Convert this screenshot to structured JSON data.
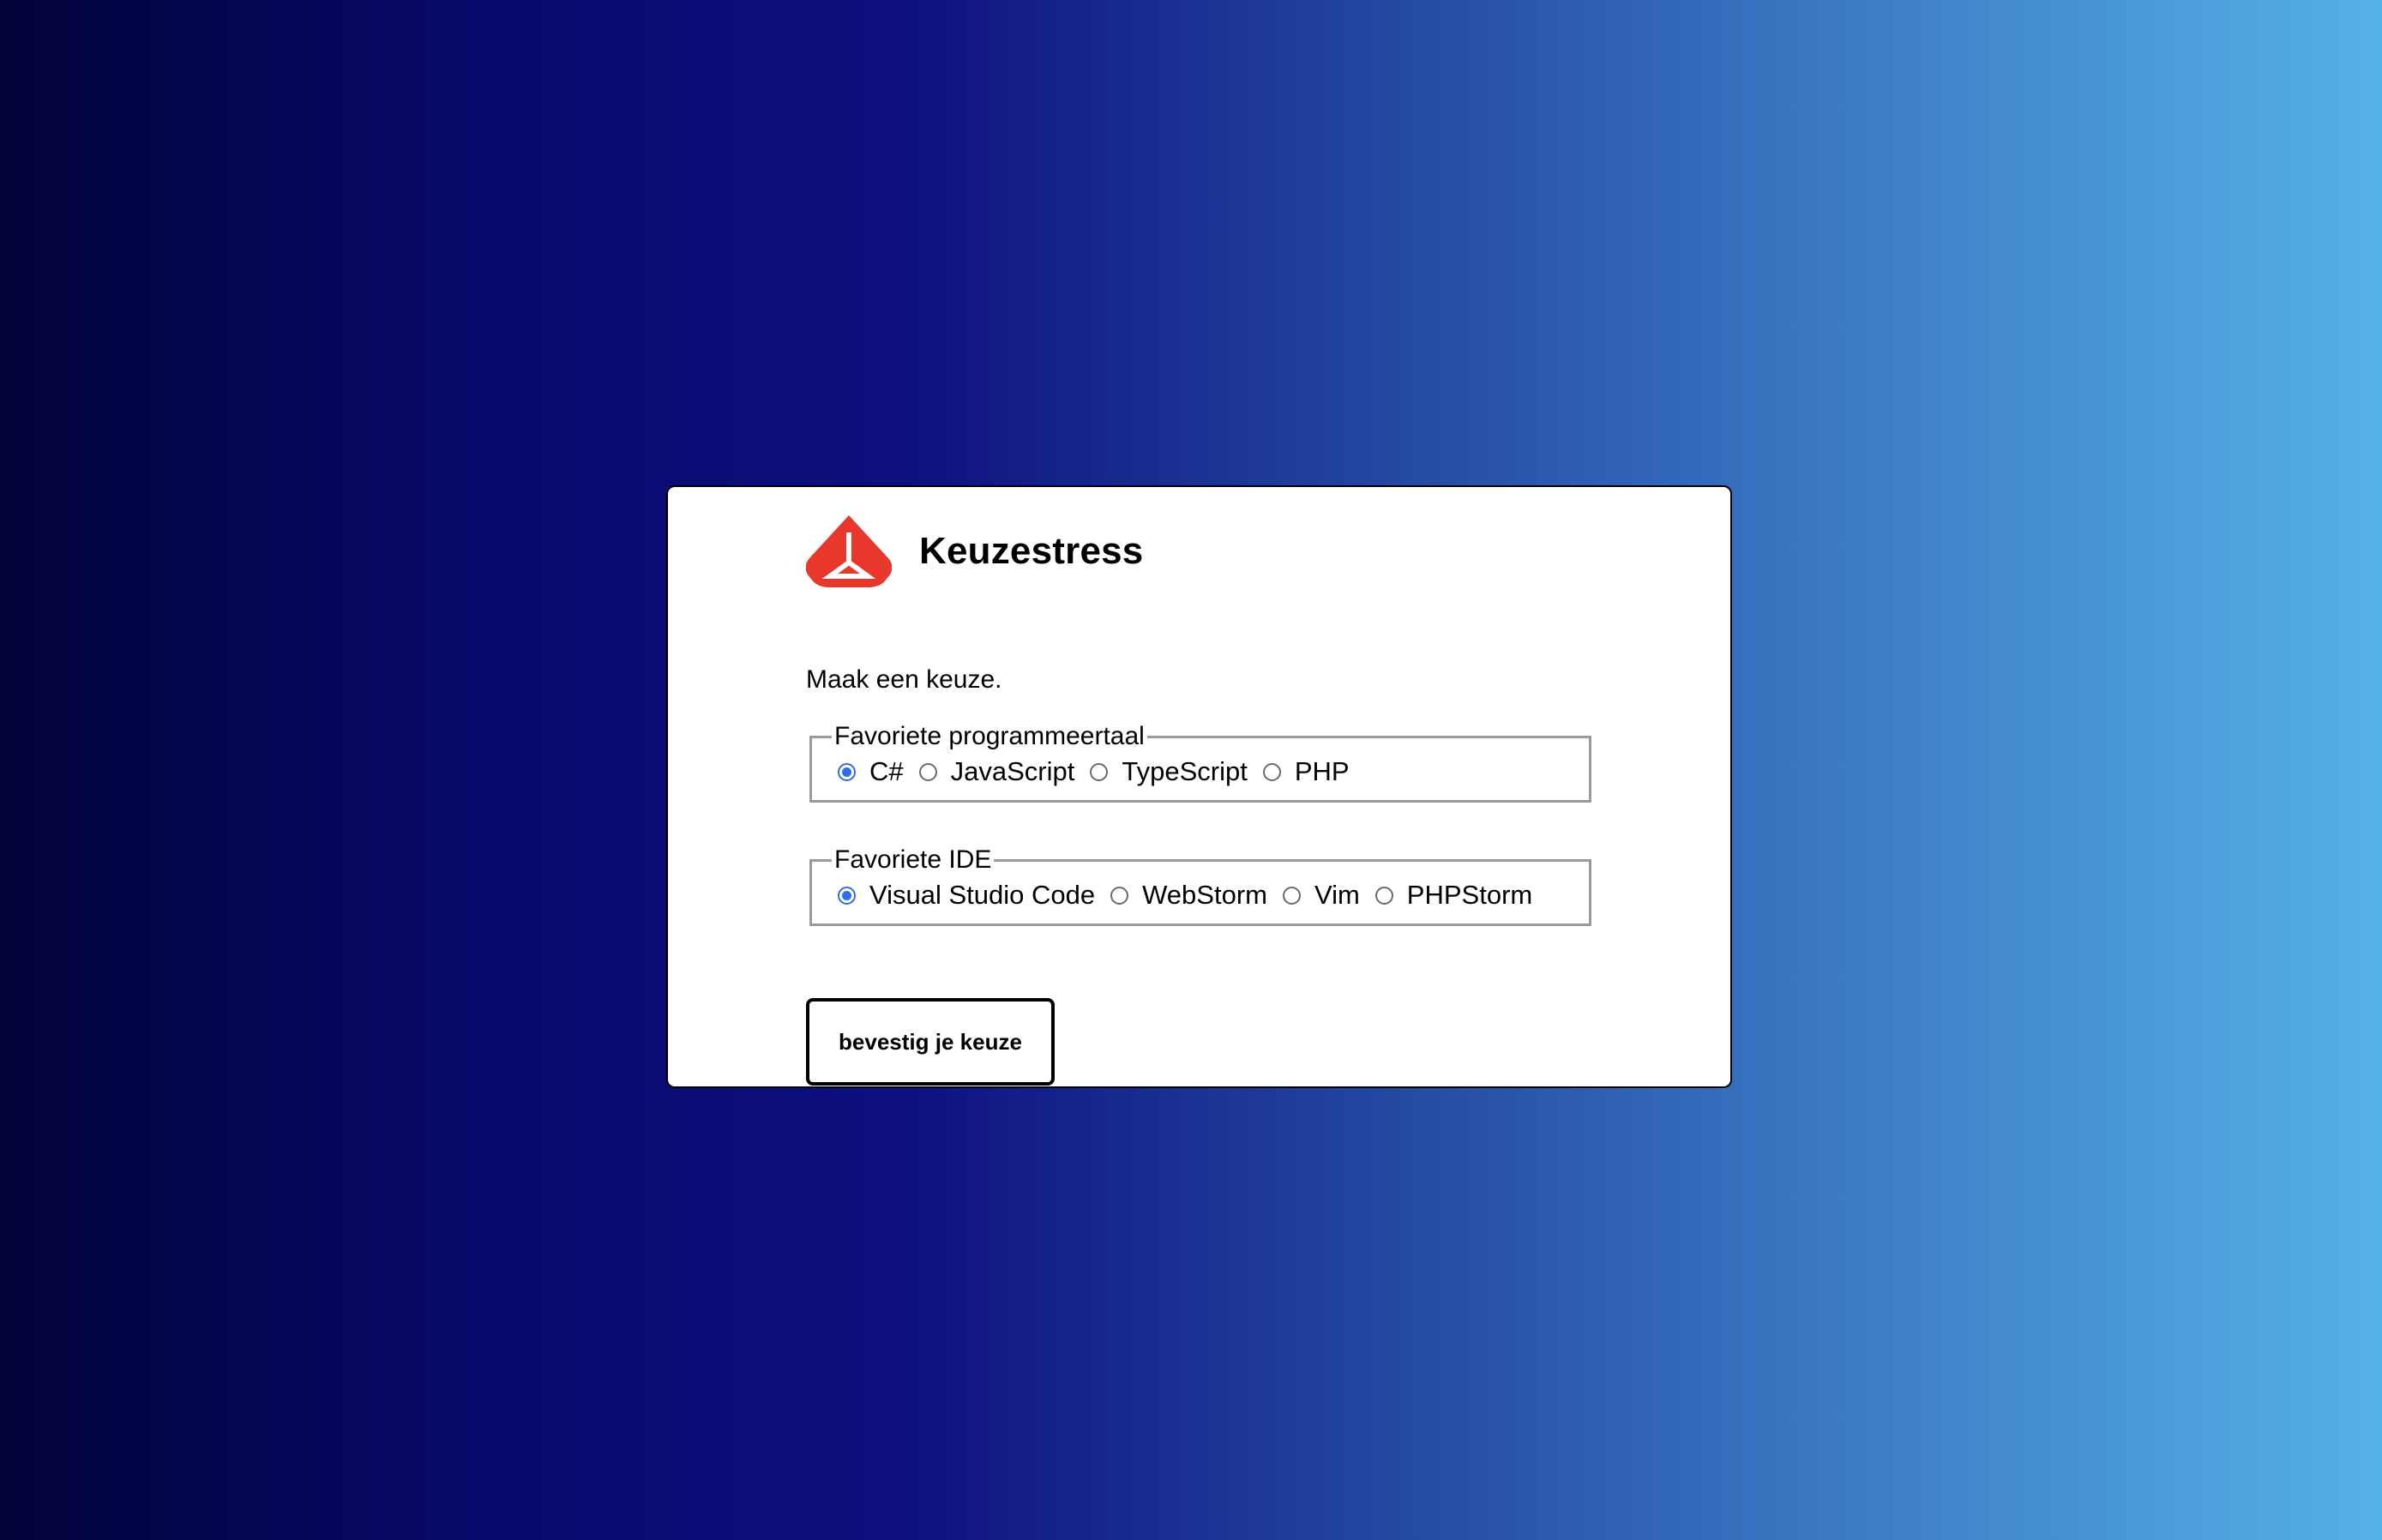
{
  "app": {
    "title": "Keuzestress",
    "logo_icon": "red-triangle-logo-icon",
    "logo_color": "#e8382b"
  },
  "intro": "Maak een keuze.",
  "groups": [
    {
      "legend": "Favoriete programmeertaal",
      "selected": "C#",
      "options": [
        "C#",
        "JavaScript",
        "TypeScript",
        "PHP"
      ]
    },
    {
      "legend": "Favoriete IDE",
      "selected": "Visual Studio Code",
      "options": [
        "Visual Studio Code",
        "WebStorm",
        "Vim",
        "PHPStorm"
      ]
    }
  ],
  "submit_label": "bevestig je keuze",
  "colors": {
    "radio_checked": "#2f6fe0",
    "background_start": "#03043a",
    "background_end": "#55b2e6"
  }
}
